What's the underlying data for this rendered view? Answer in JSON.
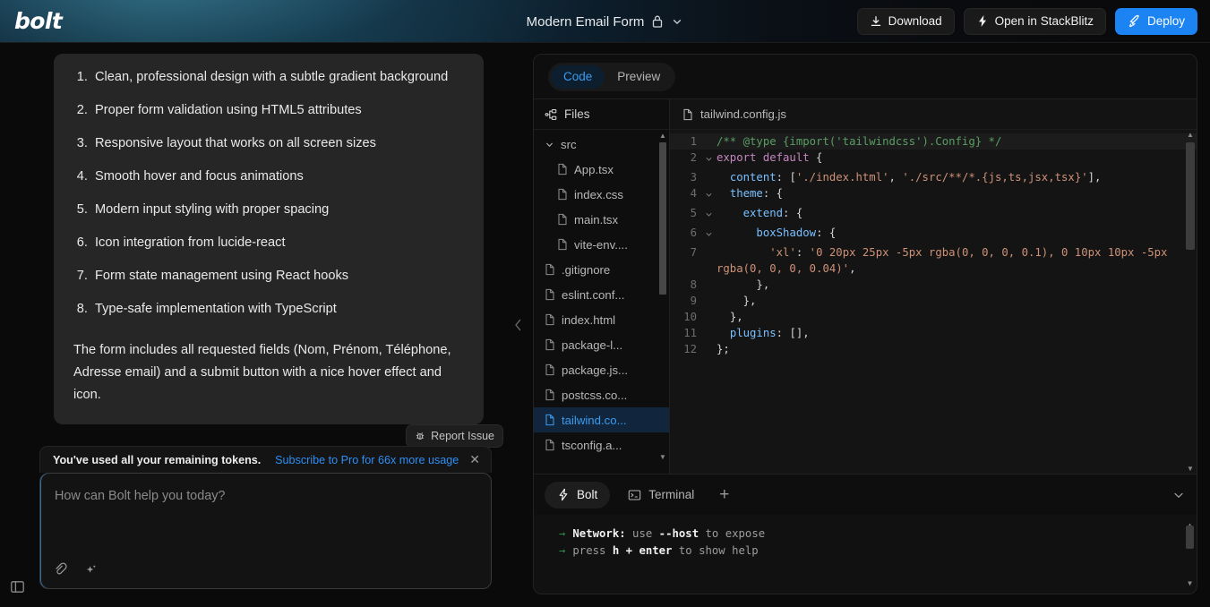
{
  "header": {
    "logo": "bolt",
    "doc_title": "Modern Email Form",
    "lock_icon": "lock-icon",
    "chevron_icon": "chevron-down-icon",
    "actions": [
      {
        "label": "Download",
        "icon": "download-icon",
        "style": "default"
      },
      {
        "label": "Open in StackBlitz",
        "icon": "lightning-icon",
        "style": "default"
      },
      {
        "label": "Deploy",
        "icon": "rocket-icon",
        "style": "primary"
      }
    ],
    "accent_color": "#1b84f2"
  },
  "chat": {
    "features": [
      "Clean, professional design with a subtle gradient background",
      "Proper form validation using HTML5 attributes",
      "Responsive layout that works on all screen sizes",
      "Smooth hover and focus animations",
      "Modern input styling with proper spacing",
      "Icon integration from lucide-react",
      "Form state management using React hooks",
      "Type-safe implementation with TypeScript"
    ],
    "paragraph": "The form includes all requested fields (Nom, Prénom, Téléphone, Adresse email) and a submit button with a nice hover effect and icon.",
    "report_issue": {
      "label": "Report Issue",
      "icon": "bug-icon"
    },
    "token_notice": {
      "text": "You've used all your remaining tokens.",
      "link": "Subscribe to Pro for 66x more usage",
      "link_color": "#2f8ef4",
      "close_icon": "close-icon"
    },
    "composer": {
      "placeholder": "How can Bolt help you today?",
      "value": "",
      "tools": [
        "paperclip-icon",
        "sparkle-icon"
      ]
    },
    "panel_toggle_icon": "sidebar-toggle-icon",
    "collapse_icon": "chevron-left-icon"
  },
  "workbench": {
    "view_tabs": [
      {
        "label": "Code",
        "active": true
      },
      {
        "label": "Preview",
        "active": false
      }
    ],
    "files_header": {
      "label": "Files",
      "icon": "file-tree-icon"
    },
    "file_tree": [
      {
        "label": "src",
        "type": "folder",
        "depth": 0,
        "expanded": true,
        "selected": false
      },
      {
        "label": "App.tsx",
        "type": "file",
        "depth": 1,
        "selected": false
      },
      {
        "label": "index.css",
        "type": "file",
        "depth": 1,
        "selected": false
      },
      {
        "label": "main.tsx",
        "type": "file",
        "depth": 1,
        "selected": false
      },
      {
        "label": "vite-env....",
        "type": "file",
        "depth": 1,
        "selected": false
      },
      {
        "label": ".gitignore",
        "type": "file",
        "depth": 0,
        "selected": false
      },
      {
        "label": "eslint.conf...",
        "type": "file",
        "depth": 0,
        "selected": false
      },
      {
        "label": "index.html",
        "type": "file",
        "depth": 0,
        "selected": false
      },
      {
        "label": "package-l...",
        "type": "file",
        "depth": 0,
        "selected": false
      },
      {
        "label": "package.js...",
        "type": "file",
        "depth": 0,
        "selected": false
      },
      {
        "label": "postcss.co...",
        "type": "file",
        "depth": 0,
        "selected": false
      },
      {
        "label": "tailwind.co...",
        "type": "file",
        "depth": 0,
        "selected": true
      },
      {
        "label": "tsconfig.a...",
        "type": "file",
        "depth": 0,
        "selected": false
      }
    ],
    "open_file": {
      "label": "tailwind.config.js",
      "icon": "file-icon"
    },
    "code_lines": [
      {
        "num": "1",
        "fold": "",
        "highlight": true,
        "parts": [
          {
            "t": "/** @type {import('tailwindcss').Config} */",
            "c": "tok-com"
          }
        ]
      },
      {
        "num": "2",
        "fold": "v",
        "highlight": false,
        "parts": [
          {
            "t": "export default",
            "c": "tok-key"
          },
          {
            "t": " {",
            "c": "tok-pun"
          }
        ]
      },
      {
        "num": "3",
        "fold": "",
        "highlight": false,
        "parts": [
          {
            "t": "  ",
            "c": "tok-pun"
          },
          {
            "t": "content",
            "c": "tok-prop"
          },
          {
            "t": ": [",
            "c": "tok-pun"
          },
          {
            "t": "'./index.html'",
            "c": "tok-str"
          },
          {
            "t": ", ",
            "c": "tok-pun"
          },
          {
            "t": "'./src/**/*.{js,ts,jsx,tsx}'",
            "c": "tok-str"
          },
          {
            "t": "],",
            "c": "tok-pun"
          }
        ]
      },
      {
        "num": "4",
        "fold": "v",
        "highlight": false,
        "parts": [
          {
            "t": "  ",
            "c": "tok-pun"
          },
          {
            "t": "theme",
            "c": "tok-prop"
          },
          {
            "t": ": {",
            "c": "tok-pun"
          }
        ]
      },
      {
        "num": "5",
        "fold": "v",
        "highlight": false,
        "parts": [
          {
            "t": "    ",
            "c": "tok-pun"
          },
          {
            "t": "extend",
            "c": "tok-prop"
          },
          {
            "t": ": {",
            "c": "tok-pun"
          }
        ]
      },
      {
        "num": "6",
        "fold": "v",
        "highlight": false,
        "parts": [
          {
            "t": "      ",
            "c": "tok-pun"
          },
          {
            "t": "boxShadow",
            "c": "tok-prop"
          },
          {
            "t": ": {",
            "c": "tok-pun"
          }
        ]
      },
      {
        "num": "7",
        "fold": "",
        "highlight": false,
        "parts": [
          {
            "t": "        ",
            "c": "tok-pun"
          },
          {
            "t": "'xl'",
            "c": "tok-str"
          },
          {
            "t": ": ",
            "c": "tok-pun"
          },
          {
            "t": "'0 20px 25px -5px rgba(0, 0, 0, 0.1), 0 10px 10px -5px rgba(0, 0, 0, 0.04)'",
            "c": "tok-str"
          },
          {
            "t": ",",
            "c": "tok-pun"
          }
        ]
      },
      {
        "num": "8",
        "fold": "",
        "highlight": false,
        "parts": [
          {
            "t": "      },",
            "c": "tok-pun"
          }
        ]
      },
      {
        "num": "9",
        "fold": "",
        "highlight": false,
        "parts": [
          {
            "t": "    },",
            "c": "tok-pun"
          }
        ]
      },
      {
        "num": "10",
        "fold": "",
        "highlight": false,
        "parts": [
          {
            "t": "  },",
            "c": "tok-pun"
          }
        ]
      },
      {
        "num": "11",
        "fold": "",
        "highlight": false,
        "parts": [
          {
            "t": "  ",
            "c": "tok-pun"
          },
          {
            "t": "plugins",
            "c": "tok-prop"
          },
          {
            "t": ": [],",
            "c": "tok-pun"
          }
        ]
      },
      {
        "num": "12",
        "fold": "",
        "highlight": false,
        "parts": [
          {
            "t": "};",
            "c": "tok-pun"
          }
        ]
      }
    ],
    "bottom_tabs": [
      {
        "label": "Bolt",
        "icon": "lightning-icon",
        "active": true
      },
      {
        "label": "Terminal",
        "icon": "terminal-icon",
        "active": false
      }
    ],
    "add_tab_label": "+",
    "collapse_panel_icon": "chevron-down-icon",
    "terminal_lines": [
      {
        "arrow": "→",
        "parts": [
          {
            "t": "Network:",
            "b": true
          },
          {
            "t": " use ",
            "b": false
          },
          {
            "t": "--host",
            "b": true
          },
          {
            "t": " to expose",
            "b": false
          }
        ]
      },
      {
        "arrow": "→",
        "parts": [
          {
            "t": "press ",
            "b": false
          },
          {
            "t": "h + enter",
            "b": true
          },
          {
            "t": " to show help",
            "b": false
          }
        ]
      }
    ]
  }
}
